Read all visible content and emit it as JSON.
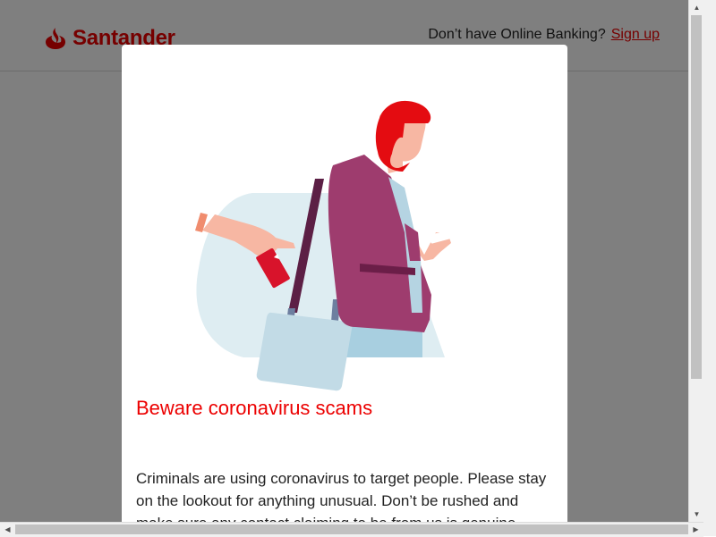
{
  "header": {
    "logo_text": "Santander",
    "prompt": "Don’t have Online Banking?",
    "signup_link": "Sign up"
  },
  "modal": {
    "title": "Beware coronavirus scams",
    "body": "Criminals are using coronavirus to target people. Please stay on the lookout for anything unusual. Don’t be rushed and make sure any contact claiming to be from us is genuine."
  },
  "icons": {
    "logo": "santander-flame-icon",
    "illustration": "pickpocket-illustration",
    "scroll_up": "arrow-up-icon",
    "scroll_down": "arrow-down-icon",
    "scroll_left": "arrow-left-icon",
    "scroll_right": "arrow-right-icon"
  },
  "colors": {
    "brand_red": "#ec0000",
    "overlay": "#808080",
    "jacket": "#9e3c6e",
    "card_red": "#d8132b",
    "bag": "#c2dbe6",
    "background_shape": "#deedf2"
  }
}
